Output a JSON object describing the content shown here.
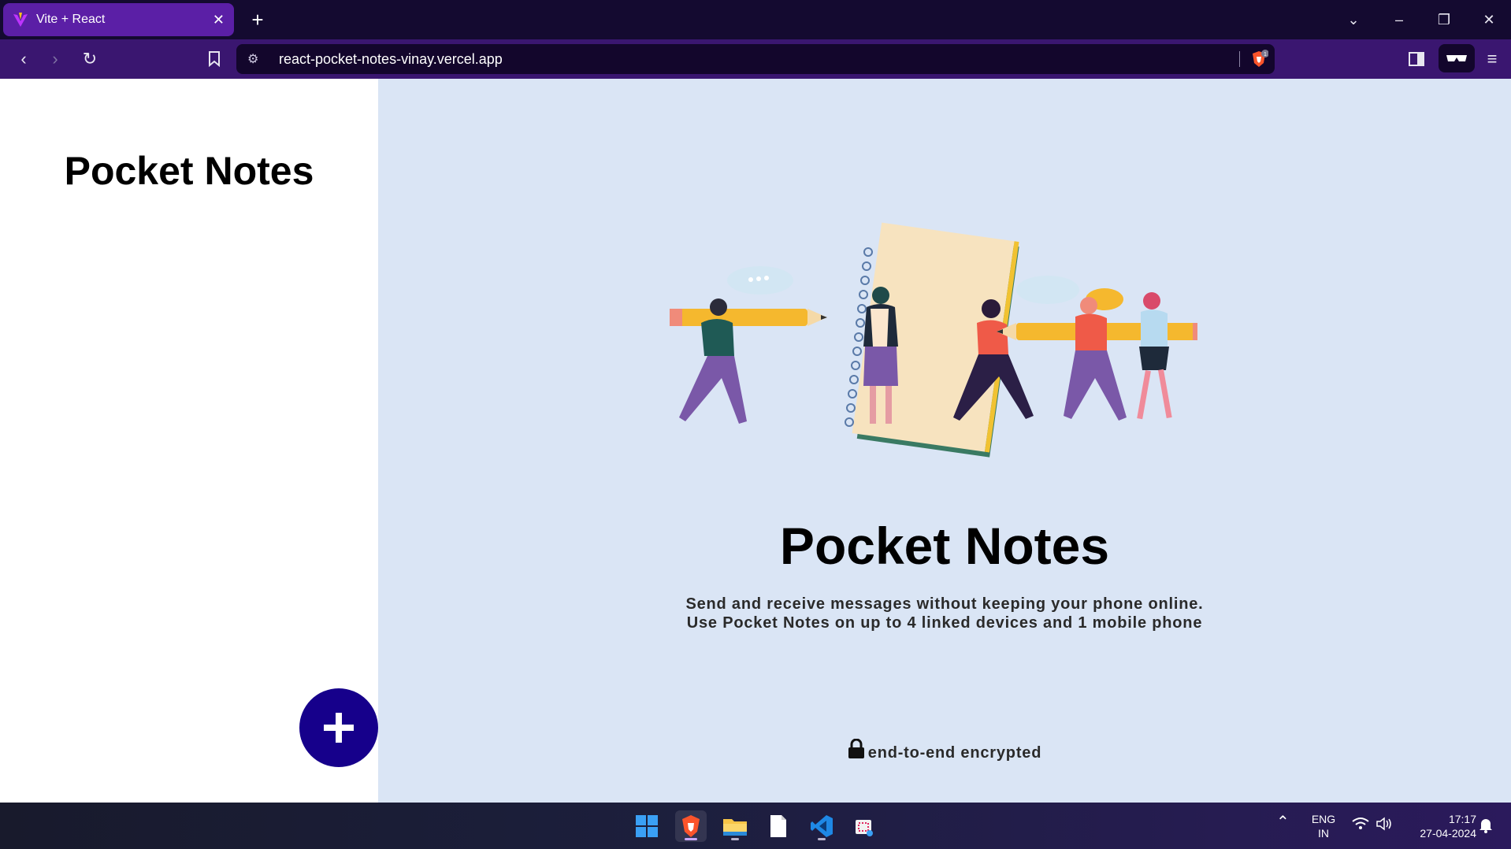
{
  "browser": {
    "tab_title": "Vite + React",
    "url": "react-pocket-notes-vinay.vercel.app",
    "shield_count": "1"
  },
  "sidebar": {
    "title": "Pocket Notes",
    "add_button_icon": "plus-icon"
  },
  "main": {
    "title": "Pocket Notes",
    "description_line1": "Send and receive messages without keeping your phone online.",
    "description_line2": "Use Pocket Notes on up to 4 linked devices and 1 mobile phone",
    "encryption_text": "end-to-end encrypted",
    "encryption_icon": "lock-icon"
  },
  "taskbar": {
    "language_top": "ENG",
    "language_bottom": "IN",
    "time": "17:17",
    "date": "27-04-2024"
  },
  "colors": {
    "sidebar_bg": "#ffffff",
    "main_bg": "#dae5f5",
    "add_button": "#16008b",
    "tab_active": "#5b1fa6",
    "toolbar": "#3a1670"
  }
}
